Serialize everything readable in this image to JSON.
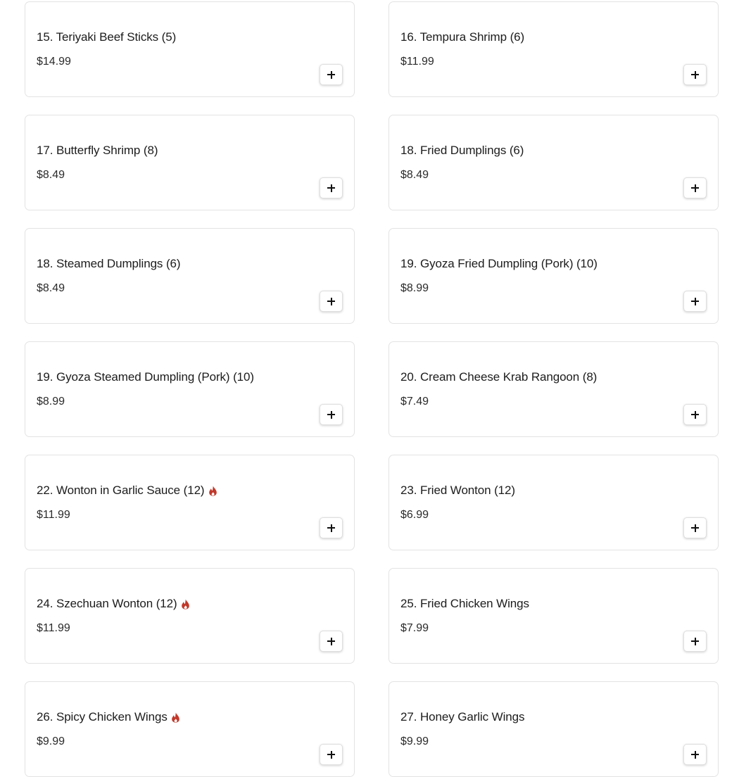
{
  "colors": {
    "spicy": "#c0392b",
    "card_border": "#e3e3e3",
    "text": "#1c1c1c"
  },
  "menu": {
    "items": [
      {
        "name": "15. Teriyaki Beef Sticks (5)",
        "price": "$14.99",
        "spicy": false,
        "add_icon": "plus-icon"
      },
      {
        "name": "16. Tempura Shrimp (6)",
        "price": "$11.99",
        "spicy": false,
        "add_icon": "plus-icon"
      },
      {
        "name": "17. Butterfly Shrimp (8)",
        "price": "$8.49",
        "spicy": false,
        "add_icon": "plus-icon"
      },
      {
        "name": "18. Fried Dumplings (6)",
        "price": "$8.49",
        "spicy": false,
        "add_icon": "plus-icon"
      },
      {
        "name": "18. Steamed Dumplings (6)",
        "price": "$8.49",
        "spicy": false,
        "add_icon": "plus-icon"
      },
      {
        "name": "19. Gyoza Fried Dumpling (Pork) (10)",
        "price": "$8.99",
        "spicy": false,
        "add_icon": "plus-icon"
      },
      {
        "name": "19. Gyoza Steamed Dumpling (Pork) (10)",
        "price": "$8.99",
        "spicy": false,
        "add_icon": "plus-icon"
      },
      {
        "name": "20. Cream Cheese Krab Rangoon (8)",
        "price": "$7.49",
        "spicy": false,
        "add_icon": "plus-icon"
      },
      {
        "name": "22. Wonton in Garlic Sauce (12)",
        "price": "$11.99",
        "spicy": true,
        "spicy_icon": "flame-icon",
        "add_icon": "plus-icon"
      },
      {
        "name": "23. Fried Wonton (12)",
        "price": "$6.99",
        "spicy": false,
        "add_icon": "plus-icon"
      },
      {
        "name": "24. Szechuan Wonton (12)",
        "price": "$11.99",
        "spicy": true,
        "spicy_icon": "flame-icon",
        "add_icon": "plus-icon"
      },
      {
        "name": "25. Fried Chicken Wings",
        "price": "$7.99",
        "spicy": false,
        "add_icon": "plus-icon"
      },
      {
        "name": "26. Spicy Chicken Wings",
        "price": "$9.99",
        "spicy": true,
        "spicy_icon": "flame-icon",
        "add_icon": "plus-icon"
      },
      {
        "name": "27. Honey Garlic Wings",
        "price": "$9.99",
        "spicy": false,
        "add_icon": "plus-icon"
      }
    ]
  }
}
